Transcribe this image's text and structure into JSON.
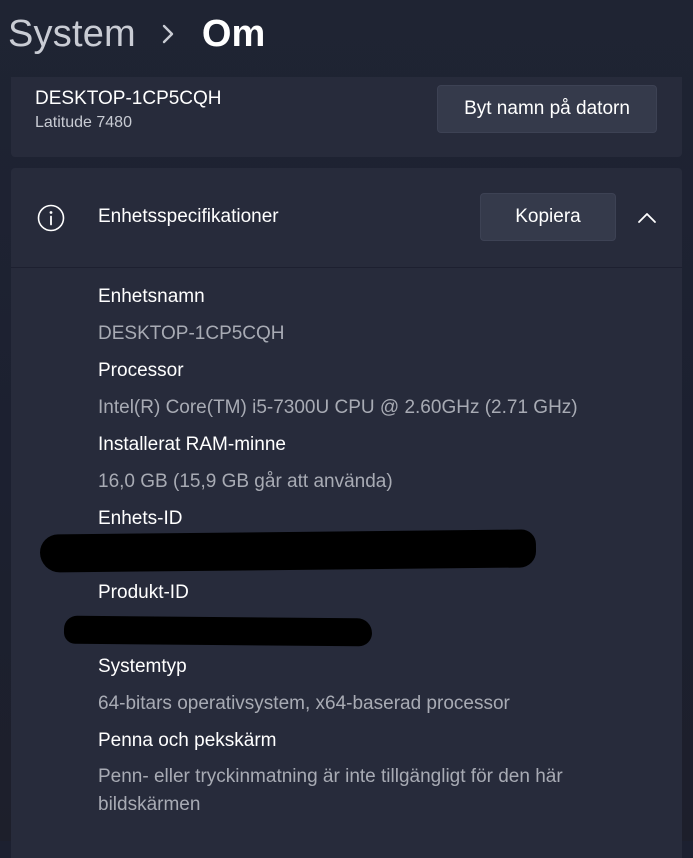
{
  "breadcrumb": {
    "parent": "System",
    "current": "Om"
  },
  "device": {
    "name": "DESKTOP-1CP5CQH",
    "model": "Latitude 7480",
    "rename_label": "Byt namn på datorn"
  },
  "specs": {
    "title": "Enhetsspecifikationer",
    "copy_label": "Kopiera",
    "items": [
      {
        "label": "Enhetsnamn",
        "value": "DESKTOP-1CP5CQH"
      },
      {
        "label": "Processor",
        "value": "Intel(R) Core(TM) i5-7300U CPU @ 2.60GHz (2.71 GHz)"
      },
      {
        "label": "Installerat RAM-minne",
        "value": "16,0 GB (15,9 GB går att använda)"
      },
      {
        "label": "Enhets-ID",
        "value": ""
      },
      {
        "label": "Produkt-ID",
        "value": ""
      },
      {
        "label": "Systemtyp",
        "value": "64-bitars operativsystem, x64-baserad processor"
      },
      {
        "label": "Penna och pekskärm",
        "value": "Penn- eller tryckinmatning är inte tillgängligt för den här bildskärmen"
      }
    ]
  },
  "icons": {
    "breadcrumb_separator": "chevron-right-icon",
    "specs_icon": "info-icon",
    "collapse": "chevron-up-icon"
  },
  "colors": {
    "background": "#1c2030",
    "card": "#272b3b",
    "button": "#353a4b",
    "secondary_text": "#a8abb4"
  }
}
